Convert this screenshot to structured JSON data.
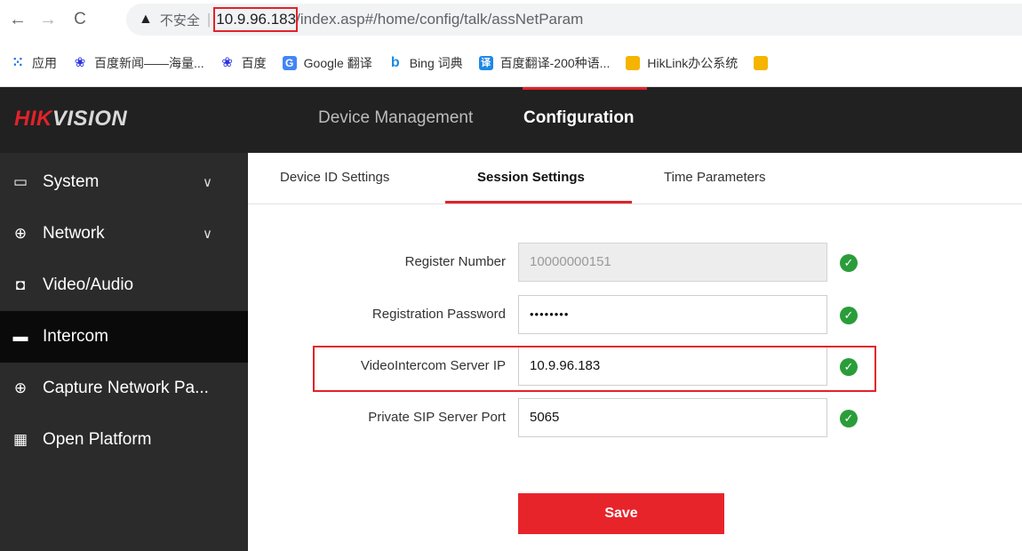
{
  "browser": {
    "back_icon": "←",
    "forward_icon": "→",
    "reload_icon": "C",
    "warning_icon": "▲",
    "insecure_label": "不安全",
    "separator": "|",
    "host": "10.9.96.183",
    "path": "/index.asp#/home/config/talk/assNetParam"
  },
  "bookmarks": [
    {
      "icon": "apps-icon",
      "label": "应用"
    },
    {
      "icon": "baidu-icon",
      "label": "百度新闻——海量..."
    },
    {
      "icon": "baidu-icon",
      "label": "百度"
    },
    {
      "icon": "google-translate-icon",
      "label": "Google 翻译"
    },
    {
      "icon": "bing-icon",
      "label": "Bing 词典"
    },
    {
      "icon": "baidu-translate-icon",
      "label": "百度翻译-200种语..."
    },
    {
      "icon": "hiklink-icon",
      "label": "HikLink办公系统"
    }
  ],
  "header": {
    "logo_red": "HIK",
    "logo_white": "VISION",
    "nav_device": "Device Management",
    "nav_config": "Configuration"
  },
  "sidebar": {
    "items": [
      {
        "label": "System",
        "icon": "system-icon",
        "chevron": "∨"
      },
      {
        "label": "Network",
        "icon": "globe-icon",
        "chevron": "∨"
      },
      {
        "label": "Video/Audio",
        "icon": "video-icon"
      },
      {
        "label": "Intercom",
        "icon": "monitor-icon"
      },
      {
        "label": "Capture Network Pa...",
        "icon": "globe-icon"
      },
      {
        "label": "Open Platform",
        "icon": "platform-icon"
      }
    ]
  },
  "tabs": {
    "device_id": "Device ID Settings",
    "session": "Session Settings",
    "time": "Time Parameters"
  },
  "form": {
    "register_number": {
      "label": "Register Number",
      "value": "10000000151"
    },
    "registration_password": {
      "label": "Registration Password",
      "value": "••••••••"
    },
    "server_ip": {
      "label": "VideoIntercom Server IP",
      "value": "10.9.96.183"
    },
    "sip_port": {
      "label": "Private SIP Server Port",
      "value": "5065"
    },
    "save_label": "Save"
  },
  "colors": {
    "accent_red": "#e2222a",
    "header_bg": "#212121",
    "sidebar_bg": "#2b2b2b",
    "ok_green": "#2a9d3a"
  }
}
